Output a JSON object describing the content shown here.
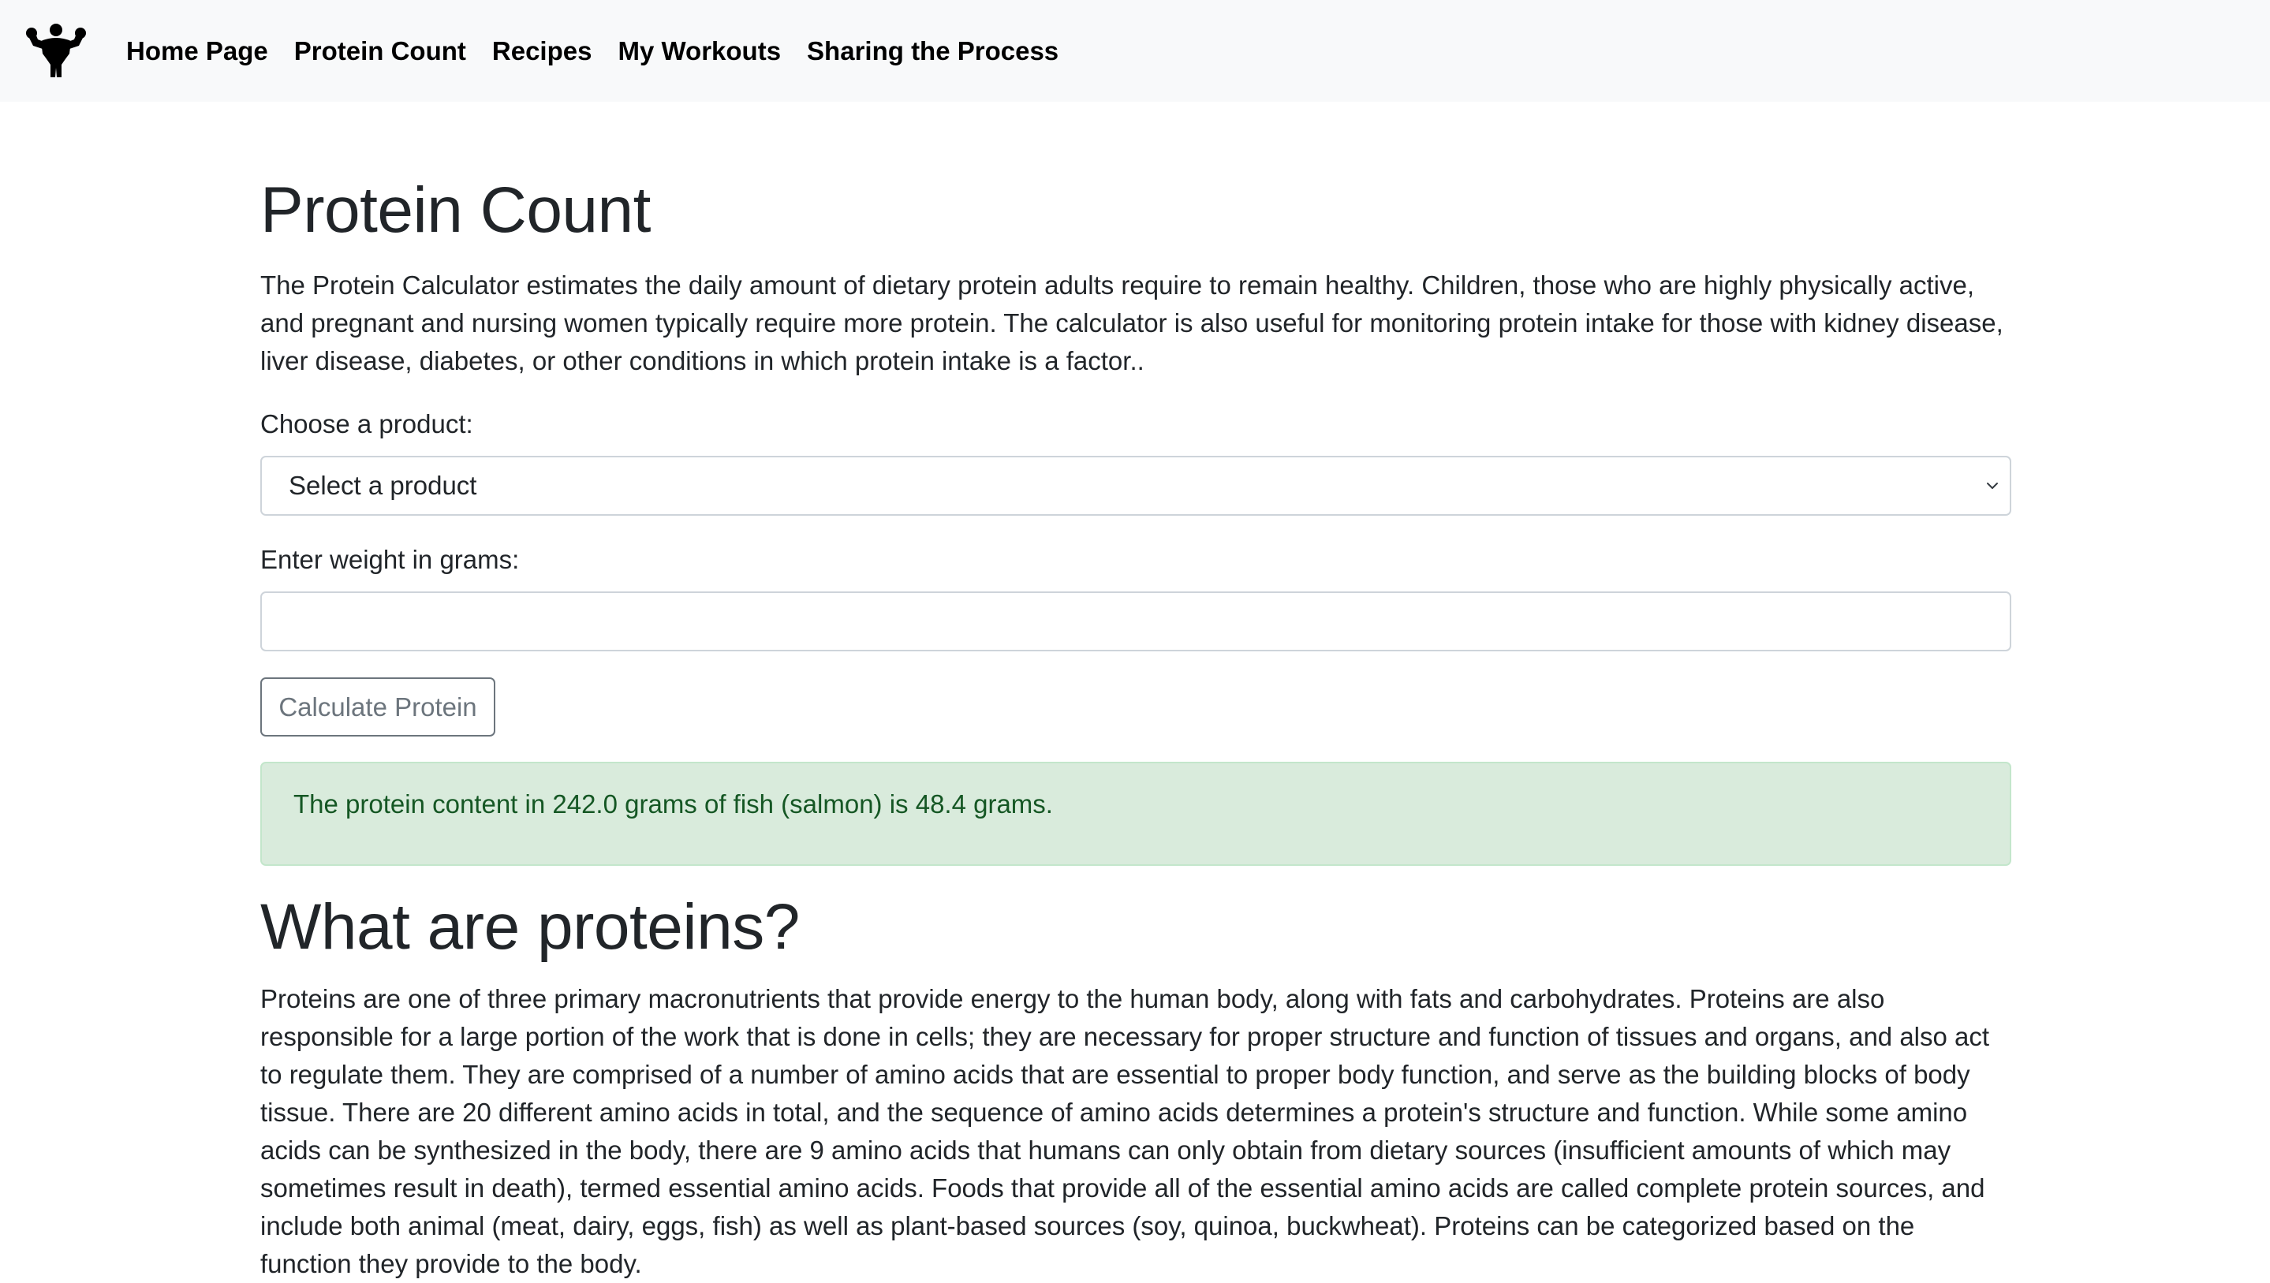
{
  "nav": {
    "logo_icon": "flexing-bodybuilder-icon",
    "links": [
      "Home Page",
      "Protein Count",
      "Recipes",
      "My Workouts",
      "Sharing the Process"
    ]
  },
  "main": {
    "title": "Protein Count",
    "intro": "The Protein Calculator estimates the daily amount of dietary protein adults require to remain healthy. Children, those who are highly physically active, and pregnant and nursing women typically require more protein. The calculator is also useful for monitoring protein intake for those with kidney disease, liver disease, diabetes, or other conditions in which protein intake is a factor..",
    "product_label": "Choose a product:",
    "product_selected": "Select a product",
    "weight_label": "Enter weight in grams:",
    "weight_value": "",
    "calculate_button": "Calculate Protein",
    "result": "The protein content in 242.0 grams of fish (salmon) is 48.4 grams."
  },
  "section": {
    "title": "What are proteins?",
    "body": "Proteins are one of three primary macronutrients that provide energy to the human body, along with fats and carbohydrates. Proteins are also responsible for a large portion of the work that is done in cells; they are necessary for proper structure and function of tissues and organs, and also act to regulate them. They are comprised of a number of amino acids that are essential to proper body function, and serve as the building blocks of body tissue. There are 20 different amino acids in total, and the sequence of amino acids determines a protein's structure and function. While some amino acids can be synthesized in the body, there are 9 amino acids that humans can only obtain from dietary sources (insufficient amounts of which may sometimes result in death), termed essential amino acids. Foods that provide all of the essential amino acids are called complete protein sources, and include both animal (meat, dairy, eggs, fish) as well as plant-based sources (soy, quinoa, buckwheat). Proteins can be categorized based on the function they provide to the body."
  },
  "colors": {
    "navbar_bg": "#f8f9fa",
    "text": "#212529",
    "alert_bg": "#d9ebdc",
    "alert_text": "#155724",
    "button_border": "#6c757d"
  }
}
